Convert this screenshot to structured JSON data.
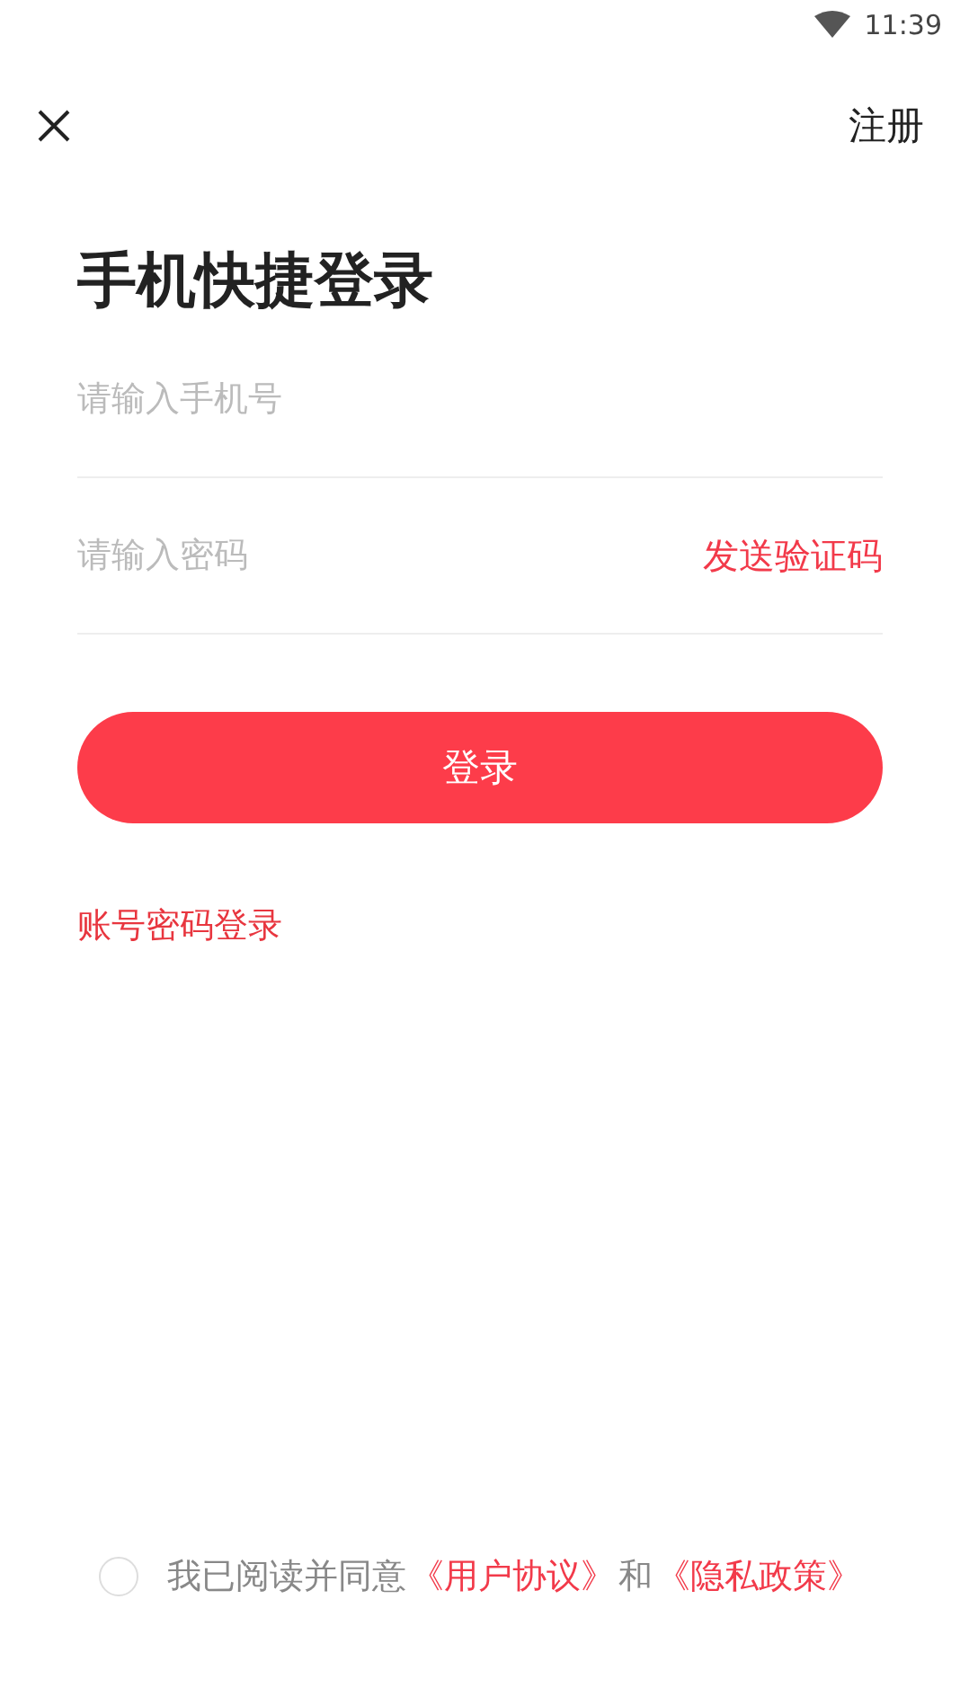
{
  "status_bar": {
    "time": "11:39"
  },
  "top_bar": {
    "register": "注册"
  },
  "title": "手机快捷登录",
  "phone_field": {
    "placeholder": "请输入手机号"
  },
  "code_field": {
    "placeholder": "请输入密码",
    "action": "发送验证码"
  },
  "login_button": "登录",
  "alt_login": "账号密码登录",
  "agreement": {
    "checked": false,
    "text": "我已阅读并同意",
    "terms": "《用户协议》",
    "and": "和",
    "privacy": "《隐私政策》"
  }
}
